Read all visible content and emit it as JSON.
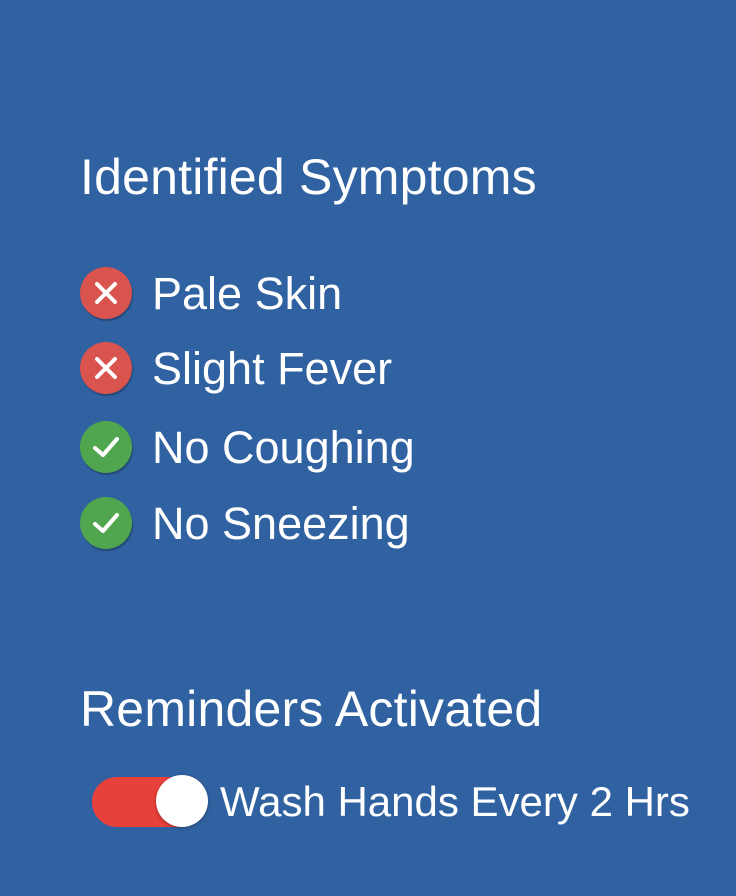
{
  "symptoms_section": {
    "title": "Identified Symptoms",
    "items": [
      {
        "label": "Pale Skin",
        "status": "negative",
        "icon": "x-circle-icon"
      },
      {
        "label": "Slight Fever",
        "status": "negative",
        "icon": "x-circle-icon"
      },
      {
        "label": "No Coughing",
        "status": "positive",
        "icon": "check-circle-icon"
      },
      {
        "label": "No Sneezing",
        "status": "positive",
        "icon": "check-circle-icon"
      }
    ]
  },
  "reminders_section": {
    "title": "Reminders Activated",
    "items": [
      {
        "label": "Wash Hands Every 2 Hrs",
        "enabled": true
      }
    ]
  },
  "colors": {
    "background": "#3061a1",
    "negative": "#d9534f",
    "positive": "#4fa64f",
    "toggle_on": "#e8403a",
    "text": "#ffffff"
  }
}
